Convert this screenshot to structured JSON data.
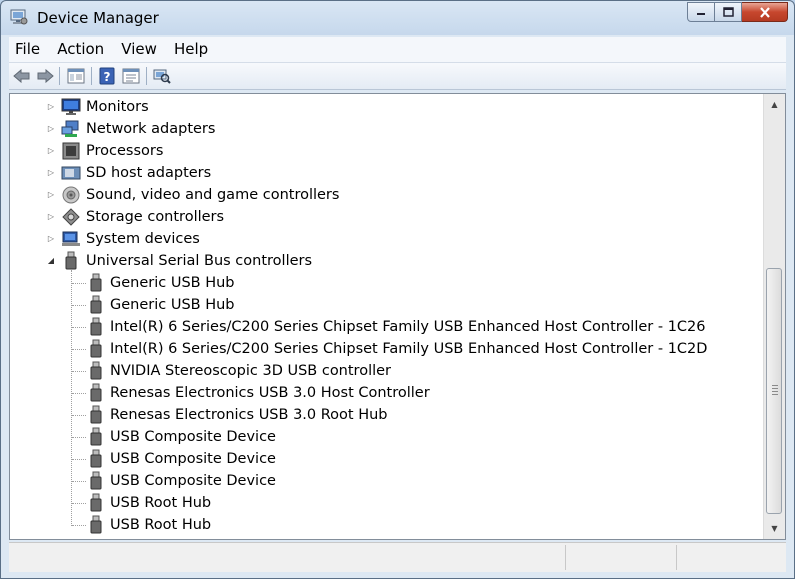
{
  "window": {
    "title": "Device Manager"
  },
  "menu": [
    "File",
    "Action",
    "View",
    "Help"
  ],
  "toolbar": {
    "icons": [
      "back-icon",
      "forward-icon",
      "show-hide-console-tree-icon",
      "help-icon",
      "properties-icon",
      "scan-hardware-icon"
    ]
  },
  "tree": {
    "categories": [
      {
        "label": "Monitors",
        "icon": "monitor-icon",
        "expanded": false
      },
      {
        "label": "Network adapters",
        "icon": "network-icon",
        "expanded": false
      },
      {
        "label": "Processors",
        "icon": "processor-icon",
        "expanded": false
      },
      {
        "label": "SD host adapters",
        "icon": "sd-card-icon",
        "expanded": false
      },
      {
        "label": "Sound, video and game controllers",
        "icon": "speaker-icon",
        "expanded": false
      },
      {
        "label": "Storage controllers",
        "icon": "storage-icon",
        "expanded": false
      },
      {
        "label": "System devices",
        "icon": "computer-icon",
        "expanded": false
      },
      {
        "label": "Universal Serial Bus controllers",
        "icon": "usb-plug-icon",
        "expanded": true
      }
    ],
    "usb_children": [
      "Generic USB Hub",
      "Generic USB Hub",
      "Intel(R) 6 Series/C200 Series Chipset Family USB Enhanced Host Controller - 1C26",
      "Intel(R) 6 Series/C200 Series Chipset Family USB Enhanced Host Controller - 1C2D",
      "NVIDIA Stereoscopic 3D USB controller",
      "Renesas Electronics USB 3.0 Host Controller",
      "Renesas Electronics USB 3.0 Root Hub",
      "USB Composite Device",
      "USB Composite Device",
      "USB Composite Device",
      "USB Root Hub",
      "USB Root Hub"
    ]
  },
  "colors": {
    "frame": "#c6d8ec",
    "close_button": "#c7472e"
  }
}
